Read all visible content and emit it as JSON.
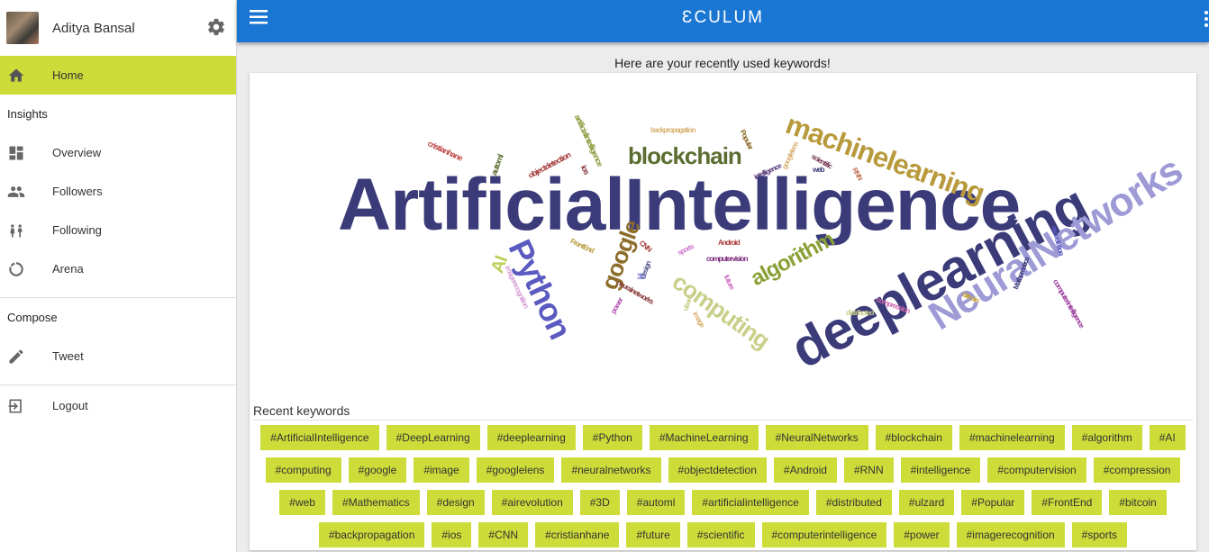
{
  "profile": {
    "name": "Aditya Bansal"
  },
  "nav": {
    "home": "Home",
    "insights_title": "Insights",
    "overview": "Overview",
    "followers": "Followers",
    "following": "Following",
    "arena": "Arena",
    "compose_title": "Compose",
    "tweet": "Tweet",
    "logout": "Logout"
  },
  "topbar": {
    "brand": "ƐCULUM"
  },
  "main": {
    "heading": "Here are your recently used keywords!",
    "recent_label": "Recent keywords"
  },
  "colors": {
    "accent": "#cddc39",
    "primary": "#1976d2"
  },
  "wordcloud": [
    {
      "t": "ArtificialIntelligence",
      "c": "#3b3b7a"
    },
    {
      "t": "deeplearning",
      "c": "#3b3b7a"
    },
    {
      "t": "NeuralNetworks",
      "c": "#9e9ad6"
    },
    {
      "t": "machinelearning",
      "c": "#b89a3c"
    },
    {
      "t": "Python",
      "c": "#5a5ac0"
    },
    {
      "t": "blockchain",
      "c": "#5b6d30"
    },
    {
      "t": "google",
      "c": "#8c6d2a"
    },
    {
      "t": "algorithm",
      "c": "#8aa036"
    },
    {
      "t": "computing",
      "c": "#c8cf88"
    },
    {
      "t": "AI",
      "c": "#bfcf5a"
    },
    {
      "t": "artificialintelligence",
      "c": "#8a9a3a"
    },
    {
      "t": "cristianhane",
      "c": "#c04a4a"
    },
    {
      "t": "automl",
      "c": "#5b6d30"
    },
    {
      "t": "objectdetection",
      "c": "#a03a3a"
    },
    {
      "t": "ios",
      "c": "#8a3a3a"
    },
    {
      "t": "backpropagation",
      "c": "#d8b070"
    },
    {
      "t": "Popular",
      "c": "#8c6d2a"
    },
    {
      "t": "intelligence",
      "c": "#5a3a7a"
    },
    {
      "t": "googlelens",
      "c": "#d8b070"
    },
    {
      "t": "scientific",
      "c": "#7a3a5a"
    },
    {
      "t": "RNN",
      "c": "#c07050"
    },
    {
      "t": "web",
      "c": "#3b3b7a"
    },
    {
      "t": "FrontEnd",
      "c": "#b89a3c"
    },
    {
      "t": "CNN",
      "c": "#a03a3a"
    },
    {
      "t": "sports",
      "c": "#d07ad0"
    },
    {
      "t": "Android",
      "c": "#b04040"
    },
    {
      "t": "computervision",
      "c": "#7a2a7a"
    },
    {
      "t": "design",
      "c": "#5a5a8a"
    },
    {
      "t": "3D",
      "c": "#7a7ad0"
    },
    {
      "t": "neuralnetworks",
      "c": "#8a3a3a"
    },
    {
      "t": "imagerecognition",
      "c": "#d7a0d7"
    },
    {
      "t": "power",
      "c": "#b050b0"
    },
    {
      "t": "ulzard",
      "c": "#c8cf88"
    },
    {
      "t": "image",
      "c": "#d8b070"
    },
    {
      "t": "future",
      "c": "#d070c0"
    },
    {
      "t": "distributed",
      "c": "#c8cf88"
    },
    {
      "t": "compression",
      "c": "#d06ab0"
    },
    {
      "t": "bitcoin",
      "c": "#c0a030"
    },
    {
      "t": "Mathematics",
      "c": "#3b3b7a"
    },
    {
      "t": "computerintelligence",
      "c": "#9a3a9a"
    },
    {
      "t": "airevolution",
      "c": "#5a5ac0"
    }
  ],
  "keywords_rows": [
    [
      "#ArtificialIntelligence",
      "#DeepLearning",
      "#deeplearning",
      "#Python",
      "#MachineLearning",
      "#NeuralNetworks",
      "#blockchain",
      "#machinelearning",
      "#algorithm",
      "#AI"
    ],
    [
      "#computing",
      "#google",
      "#image",
      "#googlelens",
      "#neuralnetworks",
      "#objectdetection",
      "#Android",
      "#RNN",
      "#intelligence",
      "#computervision",
      "#compression"
    ],
    [
      "#web",
      "#Mathematics",
      "#design",
      "#airevolution",
      "#3D",
      "#automl",
      "#artificialintelligence",
      "#distributed",
      "#ulzard",
      "#Popular",
      "#FrontEnd",
      "#bitcoin"
    ],
    [
      "#backpropagation",
      "#ios",
      "#CNN",
      "#cristianhane",
      "#future",
      "#scientific",
      "#computerintelligence",
      "#power",
      "#imagerecognition",
      "#sports"
    ]
  ]
}
